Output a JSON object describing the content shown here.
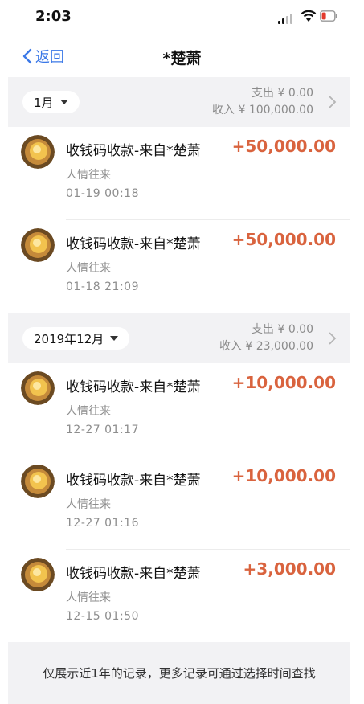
{
  "status": {
    "time": "2:03"
  },
  "nav": {
    "back_label": "返回",
    "title": "*楚萧"
  },
  "groups": [
    {
      "month": "1月",
      "expense": "支出 ¥ 0.00",
      "income": "收入 ¥ 100,000.00",
      "transactions": [
        {
          "title": "收钱码收款-来自*楚萧",
          "category": "人情往来",
          "time": "01-19  00:18",
          "amount": "+50,000.00"
        },
        {
          "title": "收钱码收款-来自*楚萧",
          "category": "人情往来",
          "time": "01-18  21:09",
          "amount": "+50,000.00"
        }
      ]
    },
    {
      "month": "2019年12月",
      "expense": "支出 ¥ 0.00",
      "income": "收入 ¥ 23,000.00",
      "transactions": [
        {
          "title": "收钱码收款-来自*楚萧",
          "category": "人情往来",
          "time": "12-27  01:17",
          "amount": "+10,000.00"
        },
        {
          "title": "收钱码收款-来自*楚萧",
          "category": "人情往来",
          "time": "12-27  01:16",
          "amount": "+10,000.00"
        },
        {
          "title": "收钱码收款-来自*楚萧",
          "category": "人情往来",
          "time": "12-15  01:50",
          "amount": "+3,000.00"
        }
      ]
    }
  ],
  "footer": {
    "text": "仅展示近1年的记录，更多记录可通过选择时间查找"
  },
  "colors": {
    "accent": "#3b78e7",
    "income": "#d9633e"
  }
}
